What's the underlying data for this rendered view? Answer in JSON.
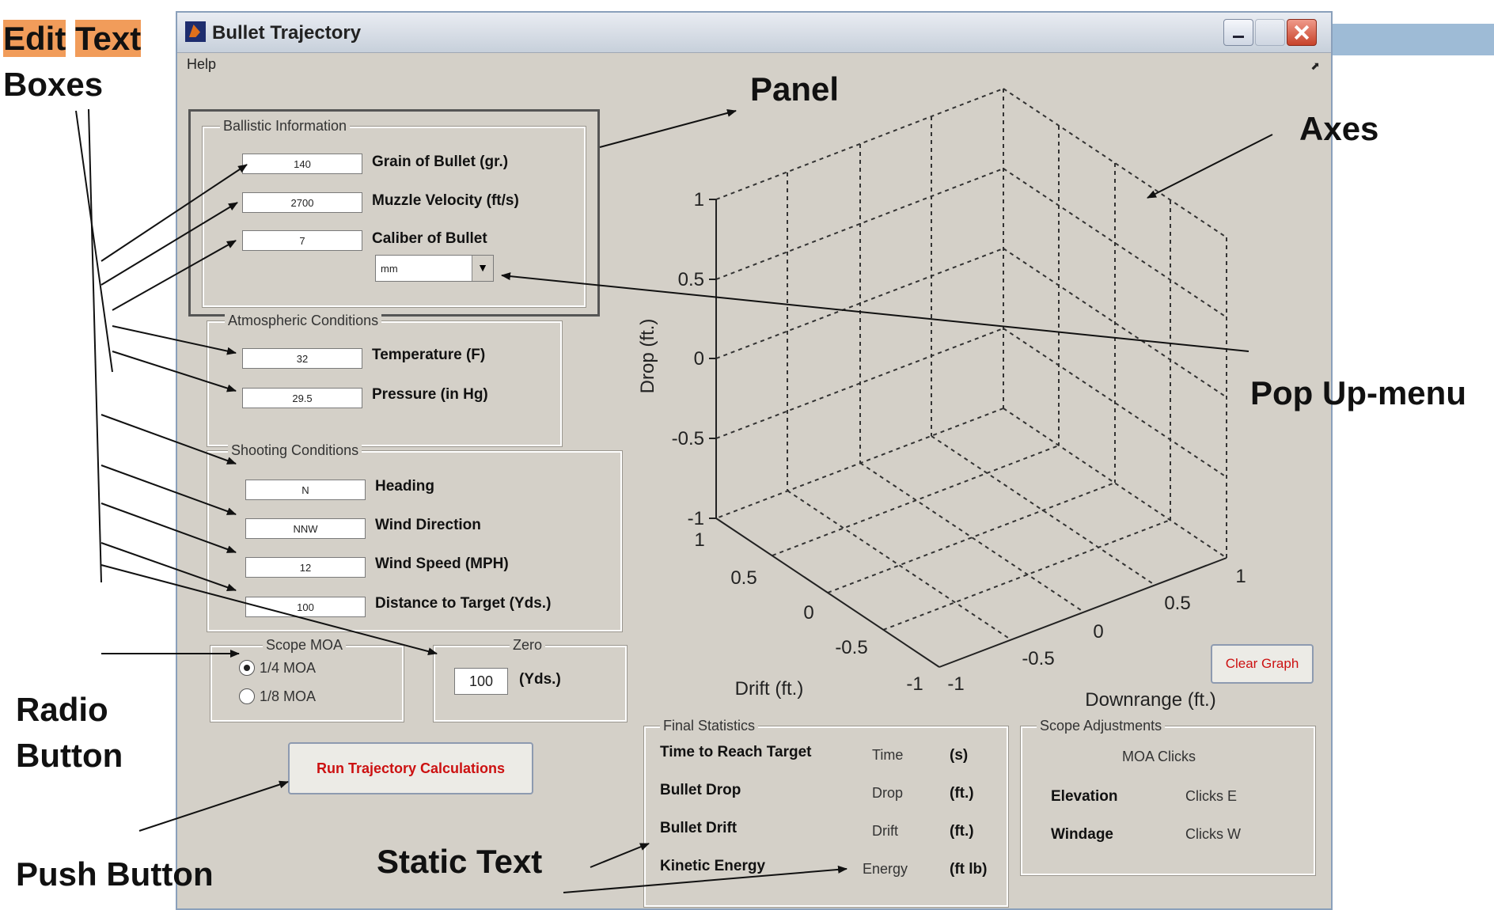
{
  "window": {
    "title": "Bullet Trajectory",
    "menu": [
      "Help"
    ]
  },
  "ballistic": {
    "title": "Ballistic Information",
    "grain": {
      "value": "140",
      "label": "Grain of Bullet (gr.)"
    },
    "velocity": {
      "value": "2700",
      "label": "Muzzle Velocity (ft/s)"
    },
    "caliber": {
      "value": "7",
      "label": "Caliber of Bullet"
    },
    "unit_select": "mm"
  },
  "atmospheric": {
    "title": "Atmospheric Conditions",
    "temperature": {
      "value": "32",
      "label": "Temperature (F)"
    },
    "pressure": {
      "value": "29.5",
      "label": "Pressure (in Hg)"
    }
  },
  "shooting": {
    "title": "Shooting Conditions",
    "heading": {
      "value": "N",
      "label": "Heading"
    },
    "wind_direction": {
      "value": "NNW",
      "label": "Wind Direction"
    },
    "wind_speed": {
      "value": "12",
      "label": "Wind Speed (MPH)"
    },
    "distance": {
      "value": "100",
      "label": "Distance to Target (Yds.)"
    }
  },
  "scope_moa": {
    "title": "Scope MOA",
    "options": [
      "1/4 MOA",
      "1/8 MOA"
    ],
    "selected": 0
  },
  "zero": {
    "title": "Zero",
    "value": "100",
    "unit": "(Yds.)"
  },
  "run_button": "Run Trajectory Calculations",
  "clear_button": "Clear Graph",
  "axes": {
    "ylabel": "Drop (ft.)",
    "xlabel": "Drift (ft.)",
    "zlabel": "Downrange (ft.)",
    "drop_ticks": [
      "1",
      "0.5",
      "0",
      "-0.5",
      "-1"
    ],
    "drift_ticks": [
      "1",
      "0.5",
      "0",
      "-0.5",
      "-1"
    ],
    "downrange_ticks": [
      "-1",
      "-0.5",
      "0",
      "0.5",
      "1"
    ],
    "range": [
      -1,
      1
    ],
    "grid": true
  },
  "final_stats": {
    "title": "Final Statistics",
    "rows": [
      {
        "label": "Time to Reach Target",
        "value": "Time",
        "unit": "(s)"
      },
      {
        "label": "Bullet Drop",
        "value": "Drop",
        "unit": "(ft.)"
      },
      {
        "label": "Bullet Drift",
        "value": "Drift",
        "unit": "(ft.)"
      },
      {
        "label": "Kinetic Energy",
        "value": "Energy",
        "unit": "(ft lb)"
      }
    ]
  },
  "scope_adjust": {
    "title": "Scope Adjustments",
    "header": "MOA Clicks",
    "rows": [
      {
        "label": "Elevation",
        "value": "Clicks E"
      },
      {
        "label": "Windage",
        "value": "Clicks W"
      }
    ]
  },
  "annotations": {
    "edit": "Edit",
    "text": "Text",
    "boxes": "Boxes",
    "panel": "Panel",
    "axes": "Axes",
    "popup": "Pop Up-menu",
    "radio1": "Radio",
    "radio2": "Button",
    "push": "Push Button",
    "static": "Static Text"
  },
  "colors": {
    "annotation_highlight": "#f19c5a",
    "button_text": "#cc1111",
    "window_bg": "#d4d0c8"
  }
}
